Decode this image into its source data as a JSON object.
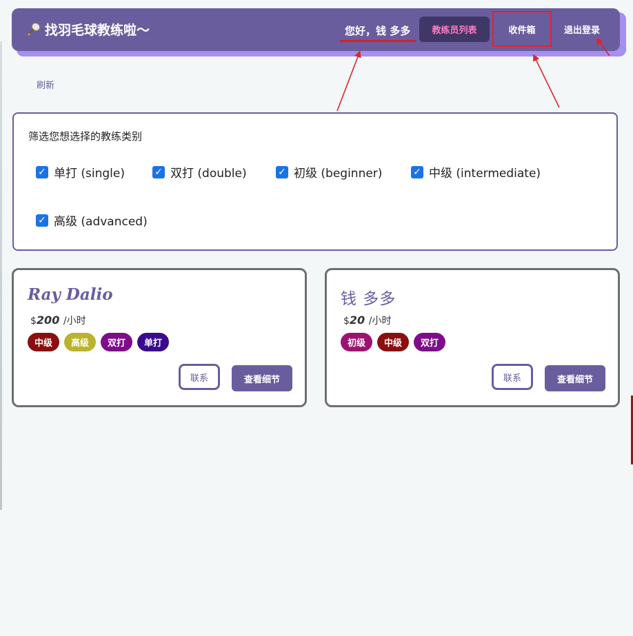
{
  "header": {
    "brand": "找羽毛球教练啦～",
    "greeting": "您好，钱 多多",
    "nav": {
      "coach_list": "教练员列表",
      "inbox": "收件箱",
      "logout": "退出登录"
    }
  },
  "refresh_label": "刷新",
  "filter": {
    "title": "筛选您想选择的教练类别",
    "options": [
      {
        "label": "单打 (single)",
        "checked": true
      },
      {
        "label": "双打 (double)",
        "checked": true
      },
      {
        "label": "初级 (beginner)",
        "checked": true
      },
      {
        "label": "中级 (intermediate)",
        "checked": true
      },
      {
        "label": "高级 (advanced)",
        "checked": true
      }
    ]
  },
  "coaches": [
    {
      "name": "Ray Dalio",
      "currency": "$",
      "price": "200",
      "unit": "/小时",
      "tags": [
        {
          "label": "中级",
          "color": "#8b0f0f"
        },
        {
          "label": "高级",
          "color": "#b9b42c"
        },
        {
          "label": "双打",
          "color": "#7d0d8a"
        },
        {
          "label": "单打",
          "color": "#3a0a8c"
        }
      ],
      "contact": "联系",
      "details": "查看细节"
    },
    {
      "name": "钱 多多",
      "currency": "$",
      "price": "20",
      "unit": "/小时",
      "tags": [
        {
          "label": "初级",
          "color": "#9c1470"
        },
        {
          "label": "中级",
          "color": "#8b0f0f"
        },
        {
          "label": "双打",
          "color": "#7d0d8a"
        }
      ],
      "contact": "联系",
      "details": "查看细节"
    }
  ],
  "colors": {
    "brand": "#6a5d9e",
    "annotation": "#d4202a",
    "checkbox": "#1a73e8"
  }
}
